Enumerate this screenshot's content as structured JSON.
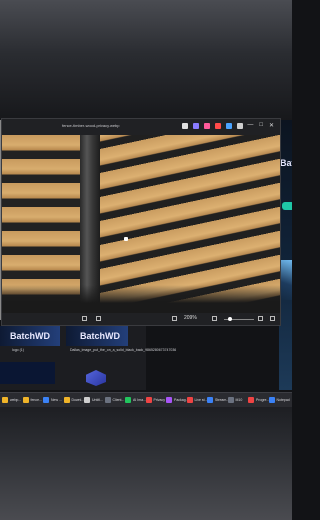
{
  "viewer": {
    "title": "fence-timber-wood-privacy.webp",
    "zoom": "209%",
    "window_controls": [
      "—",
      "□",
      "✕"
    ],
    "toolbar_icon_colors": [
      "#e0e0e0",
      "#8a7cff",
      "#ff5a9a",
      "#ff4a4a",
      "#4aa3ff",
      "#cfcfcf"
    ]
  },
  "explorer": {
    "logo_text": "BatchWD",
    "logo_text_2": "BatchWD",
    "items": [
      {
        "name": "logo (1)"
      },
      {
        "name": "Dallas_image_put_the_on_a_solid_black_back_9865280673747036"
      }
    ]
  },
  "right_peek": {
    "batch": "Batch"
  },
  "taskbar": {
    "items": [
      {
        "label": "webp...",
        "color": "#f0b429"
      },
      {
        "label": "fence...",
        "color": "#f0b429"
      },
      {
        "label": "New ...",
        "color": "#3b82f6"
      },
      {
        "label": "Downl...",
        "color": "#f0b429"
      },
      {
        "label": "Untitl...",
        "color": "#cfcfcf"
      },
      {
        "label": "Client...",
        "color": "#6b7280"
      },
      {
        "label": "AI Ima...",
        "color": "#22c55e"
      },
      {
        "label": "Privacy",
        "color": "#ef4444"
      },
      {
        "label": "Packag...",
        "color": "#a855f7"
      },
      {
        "label": "Live st...",
        "color": "#ef4444"
      },
      {
        "label": "Stream...",
        "color": "#3b82f6"
      },
      {
        "label": "M10",
        "color": "#6b7280"
      },
      {
        "label": "Progre...",
        "color": "#ef4444"
      },
      {
        "label": "Notepad",
        "color": "#3b82f6"
      }
    ]
  }
}
